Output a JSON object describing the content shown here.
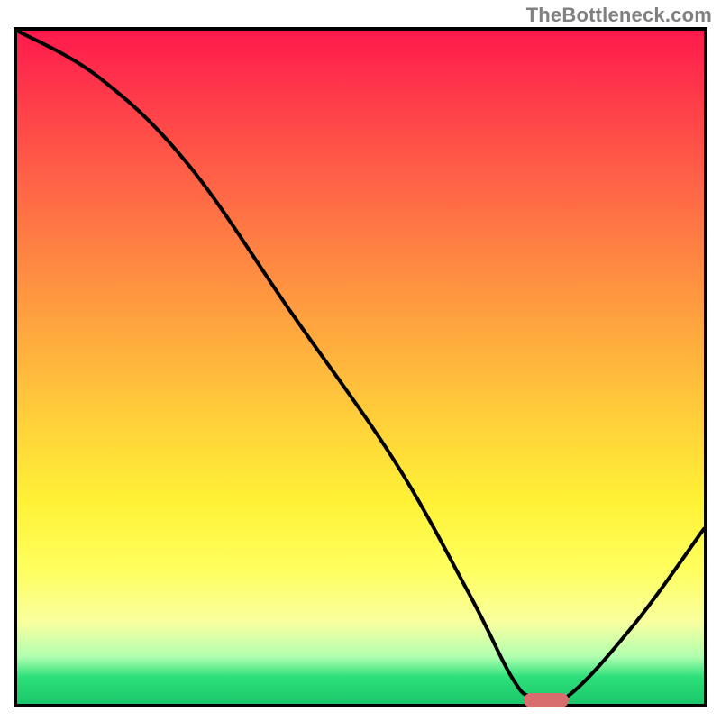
{
  "watermark": "TheBottleneck.com",
  "chart_data": {
    "type": "line",
    "title": "",
    "xlabel": "",
    "ylabel": "",
    "xlim": [
      0,
      100
    ],
    "ylim": [
      0,
      100
    ],
    "grid": false,
    "legend": false,
    "series": [
      {
        "name": "curve",
        "x": [
          0,
          12,
          25,
          40,
          55,
          66,
          72,
          75,
          80,
          90,
          100
        ],
        "values": [
          100,
          93,
          80,
          58,
          36,
          16,
          4,
          1,
          1,
          12,
          26
        ]
      }
    ],
    "annotations": {
      "minimum_marker": {
        "x": 77,
        "y": 0.5,
        "color": "#d86d6d"
      }
    },
    "background_gradient_stops": [
      {
        "pos": 0,
        "color": "#ff1a4d"
      },
      {
        "pos": 50,
        "color": "#ffb83d"
      },
      {
        "pos": 80,
        "color": "#ffff5e"
      },
      {
        "pos": 96,
        "color": "#2de07a"
      },
      {
        "pos": 100,
        "color": "#1bc76a"
      }
    ]
  },
  "style": {
    "frame_border_color": "#000000",
    "curve_stroke_color": "#000000",
    "curve_stroke_width": 4
  }
}
